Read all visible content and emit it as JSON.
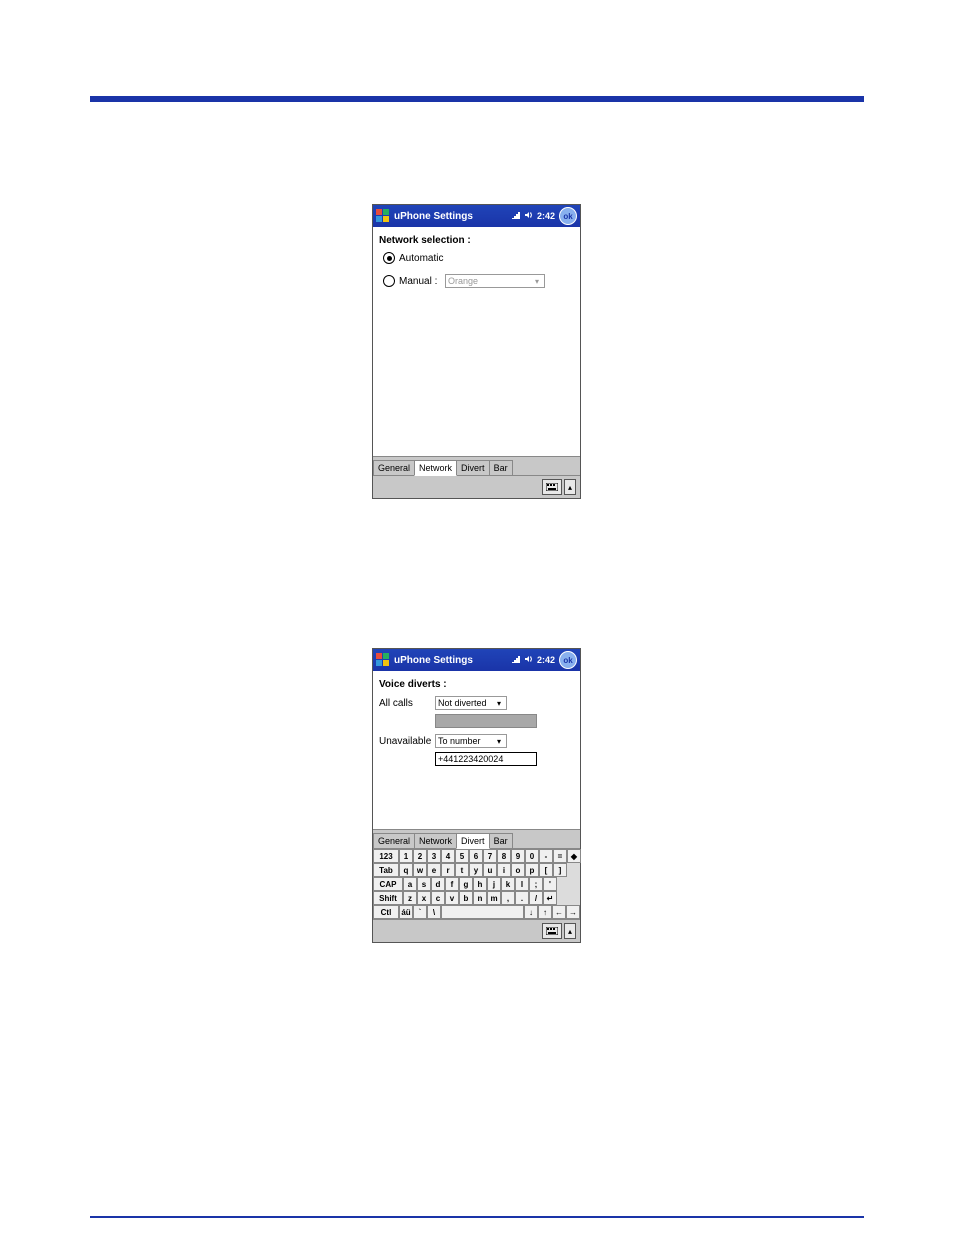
{
  "screenshot1": {
    "titlebar": {
      "app_title": "uPhone Settings",
      "time": "2:42",
      "ok_label": "ok"
    },
    "content": {
      "heading": "Network selection :",
      "radio_auto": "Automatic",
      "radio_manual": "Manual :",
      "manual_dropdown_value": "Orange"
    },
    "tabs": [
      "General",
      "Network",
      "Divert",
      "Bar"
    ],
    "active_tab_index": 1
  },
  "screenshot2": {
    "titlebar": {
      "app_title": "uPhone Settings",
      "time": "2:42",
      "ok_label": "ok"
    },
    "content": {
      "heading": "Voice diverts :",
      "row1_label": "All calls",
      "row1_dropdown": "Not diverted",
      "row2_label": "Unavailable",
      "row2_dropdown": "To number",
      "row2_input": "+441223420024"
    },
    "tabs": [
      "General",
      "Network",
      "Divert",
      "Bar"
    ],
    "active_tab_index": 2,
    "keyboard": {
      "r1": [
        "123",
        "1",
        "2",
        "3",
        "4",
        "5",
        "6",
        "7",
        "8",
        "9",
        "0",
        "-",
        "=",
        "◆"
      ],
      "r2": [
        "Tab",
        "q",
        "w",
        "e",
        "r",
        "t",
        "y",
        "u",
        "i",
        "o",
        "p",
        "[",
        "]"
      ],
      "r3": [
        "CAP",
        "a",
        "s",
        "d",
        "f",
        "g",
        "h",
        "j",
        "k",
        "l",
        ";",
        "'"
      ],
      "r4": [
        "Shift",
        "z",
        "x",
        "c",
        "v",
        "b",
        "n",
        "m",
        ",",
        ".",
        "/",
        "↵"
      ],
      "r5": [
        "Ctl",
        "áü",
        "`",
        "\\",
        " ",
        "↓",
        "↑",
        "←",
        "→"
      ]
    }
  }
}
